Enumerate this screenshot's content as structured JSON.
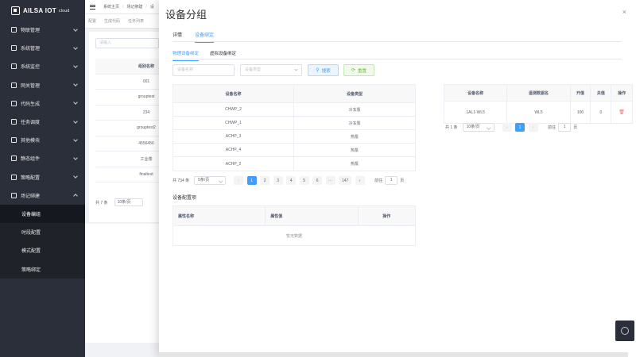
{
  "app": {
    "logo_text": "AILSA IOT",
    "logo_sub": "cloud"
  },
  "sidebar": {
    "items": [
      {
        "label": "物联管理",
        "icon": "device-icon"
      },
      {
        "label": "系统管理",
        "icon": "system-icon"
      },
      {
        "label": "系统监控",
        "icon": "monitor-icon"
      },
      {
        "label": "网关管理",
        "icon": "gateway-icon"
      },
      {
        "label": "代码生成",
        "icon": "code-icon"
      },
      {
        "label": "任务调度",
        "icon": "task-icon"
      },
      {
        "label": "其他模块",
        "icon": "module-icon"
      },
      {
        "label": "静态组件",
        "icon": "component-icon"
      },
      {
        "label": "策略配置",
        "icon": "strategy-icon"
      },
      {
        "label": "场记绑建",
        "icon": "scene-icon",
        "expanded": true
      }
    ],
    "subitems": [
      {
        "label": "设备编组",
        "active": true
      },
      {
        "label": "时段配置"
      },
      {
        "label": "模式配置"
      },
      {
        "label": "策略绑定"
      }
    ]
  },
  "navbar": {
    "breadcrumbs": [
      "系统主页",
      "场记绑建",
      "设"
    ]
  },
  "tagsbar": {
    "tags": [
      "配置",
      "生成代码",
      "任务列表"
    ]
  },
  "bg": {
    "search_placeholder": "请输入",
    "column": "组别名称",
    "rows": [
      "001",
      "grouptest",
      "234",
      "grouptest2",
      "4556456",
      "工业楼",
      "finaltest"
    ],
    "total": "共 7 条",
    "page_size": "10条/页"
  },
  "drawer": {
    "title": "设备分组",
    "close": "×",
    "tabs": [
      {
        "label": "详情",
        "active": false
      },
      {
        "label": "设备绑定",
        "active": true
      }
    ],
    "subtabs": [
      {
        "label": "物理设备绑定",
        "active": true
      },
      {
        "label": "虚拟设备绑定",
        "active": false
      }
    ],
    "filters": {
      "name_placeholder": "设备名称",
      "type_placeholder": "设备类型",
      "search_label": "搜索",
      "reset_label": "重置"
    },
    "device_table": {
      "headers": [
        "设备名称",
        "设备类型"
      ],
      "rows": [
        [
          "CHWP_2",
          "冷冻泵"
        ],
        [
          "CHWP_1",
          "冷冻泵"
        ],
        [
          "ACHP_3",
          "热泵"
        ],
        [
          "ACHP_4",
          "热泵"
        ],
        [
          "ACHP_2",
          "热泵"
        ]
      ]
    },
    "device_pager": {
      "total": "共 734 条",
      "size": "5条/页",
      "pages": [
        "1",
        "2",
        "3",
        "4",
        "5",
        "6",
        "···",
        "147"
      ],
      "current": "1",
      "goto_label": "前往",
      "goto_value": "1",
      "goto_suffix": "页"
    },
    "bound_table": {
      "headers": [
        "设备名称",
        "遥测数据名",
        "开值",
        "关值",
        "操作"
      ],
      "rows": [
        [
          "1AL1-WL5",
          "WL5",
          "100",
          "0"
        ]
      ]
    },
    "bound_pager": {
      "total": "共 1 条",
      "size": "10条/页",
      "pages": [
        "1"
      ],
      "goto_label": "前往",
      "goto_value": "1",
      "goto_suffix": "页"
    },
    "config": {
      "title": "设备配置项",
      "headers": [
        "属性名称",
        "属性值",
        "操作"
      ],
      "empty": "暂无数据"
    }
  }
}
